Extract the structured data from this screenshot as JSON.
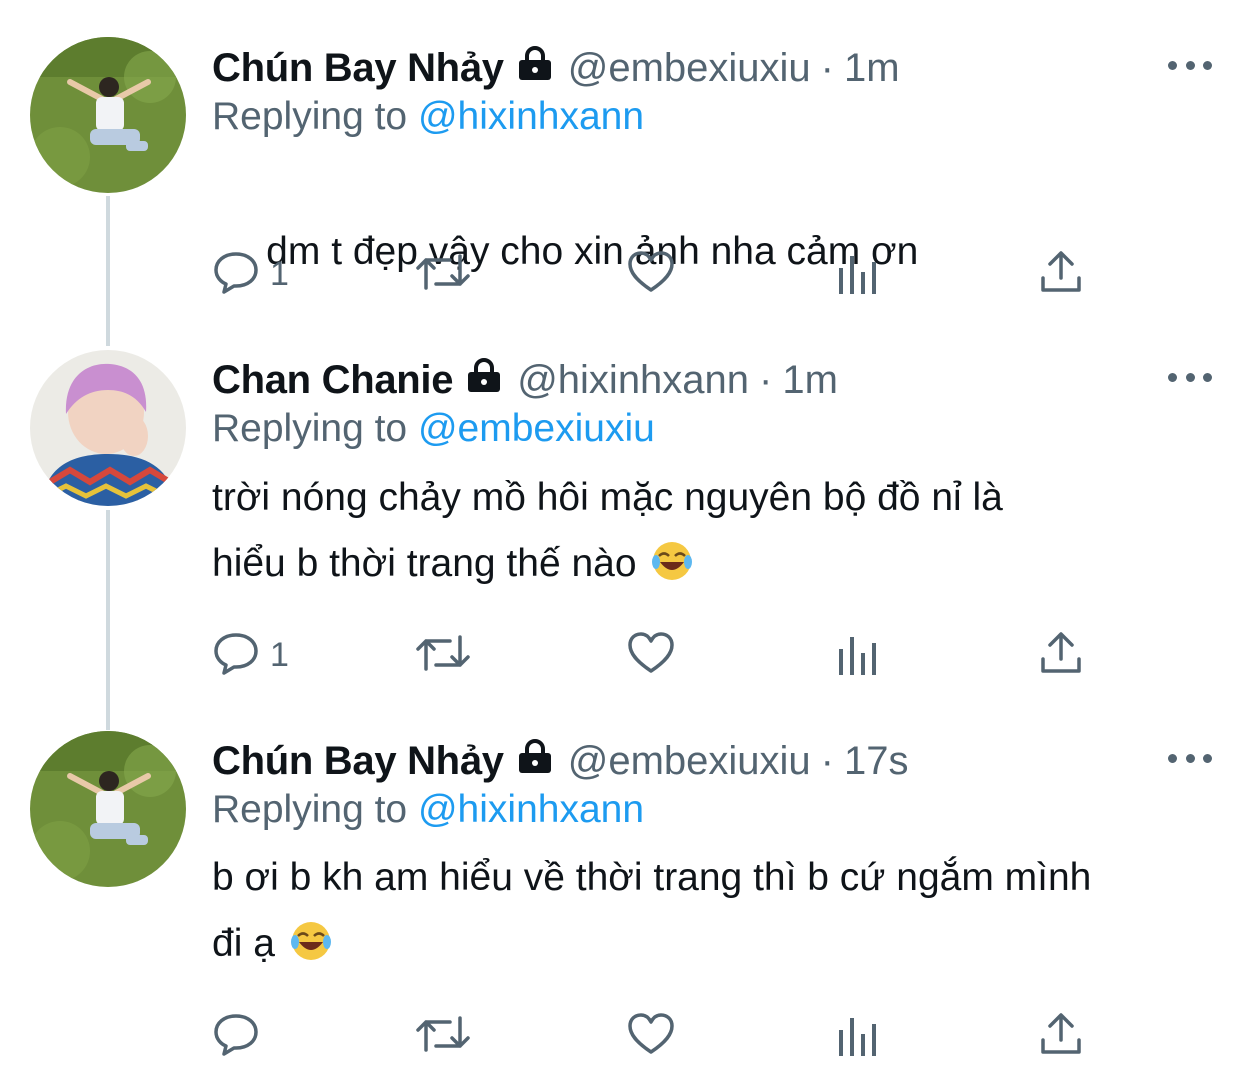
{
  "colors": {
    "accent": "#1d9bf0",
    "muted": "#536471",
    "text": "#0f1419",
    "thread_line": "#cfd9de"
  },
  "tweets": [
    {
      "name": "Chún Bay Nhảy",
      "handle": "@embexiuxiu",
      "time": "1m",
      "replying_label": "Replying to",
      "replying_to": "@hixinhxann",
      "text_lines": [
        " dm t đẹp vậy cho xin ảnh nha cảm ơn"
      ],
      "reply_count": "1",
      "avatar": "avatar-boy-on-grass",
      "icons": [
        "lock-icon",
        "more-icon",
        "reply-icon",
        "retweet-icon",
        "like-icon",
        "analytics-icon",
        "share-icon"
      ]
    },
    {
      "name": "Chan Chanie",
      "handle": "@hixinhxann",
      "time": "1m",
      "replying_label": "Replying to",
      "replying_to": "@embexiuxiu",
      "text_lines": [
        "trời nóng chảy mồ hôi mặc nguyên bộ đồ nỉ là",
        "hiểu b thời trang thế nào"
      ],
      "reply_count": "1",
      "avatar": "avatar-pink-hair-boy",
      "icons": [
        "lock-icon",
        "more-icon",
        "reply-icon",
        "retweet-icon",
        "like-icon",
        "analytics-icon",
        "share-icon",
        "laughing-emoji"
      ]
    },
    {
      "name": "Chún Bay Nhảy",
      "handle": "@embexiuxiu",
      "time": "17s",
      "replying_label": "Replying to",
      "replying_to": "@hixinhxann",
      "text_lines": [
        "b ơi b kh am hiểu về thời trang thì b cứ ngắm mình",
        "đi ạ"
      ],
      "reply_count": "",
      "avatar": "avatar-boy-on-grass",
      "icons": [
        "lock-icon",
        "more-icon",
        "reply-icon",
        "retweet-icon",
        "like-icon",
        "analytics-icon",
        "share-icon",
        "laughing-emoji"
      ]
    }
  ]
}
